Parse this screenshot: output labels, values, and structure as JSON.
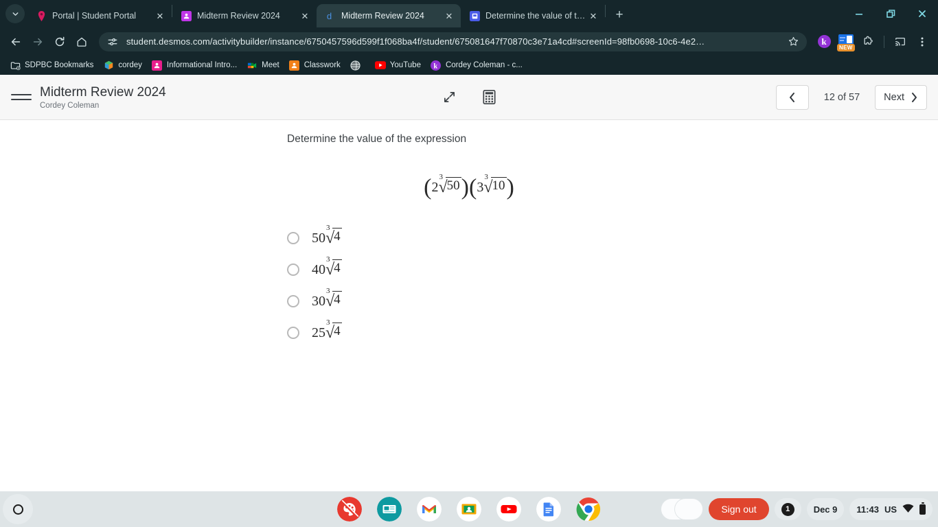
{
  "browser": {
    "tab_search_icon": "chevron-down-icon",
    "tabs": [
      {
        "title": "Portal | Student Portal",
        "favicon": "portal-pin-icon",
        "active": false
      },
      {
        "title": "Midterm Review 2024",
        "favicon": "classroom-icon",
        "active": false
      },
      {
        "title": "Midterm Review 2024",
        "favicon": "desmos-icon",
        "active": true
      },
      {
        "title": "Determine the value of the exp...",
        "favicon": "slides-icon",
        "active": false
      }
    ],
    "new_tab_label": "+",
    "window_controls": {
      "minimize": "minimize-icon",
      "maximize": "restore-icon",
      "close": "close-icon"
    },
    "toolbar": {
      "back_icon": "back-arrow-icon",
      "forward_icon": "forward-arrow-icon",
      "reload_icon": "reload-icon",
      "home_icon": "home-icon",
      "site_info_icon": "site-settings-icon",
      "url": "student.desmos.com/activitybuilder/instance/6750457596d599f1f068ba4f/student/675081647f70870c3e71a4cd#screenId=98fb0698-10c6-4e2…",
      "star_icon": "bookmark-star-icon",
      "extension_k_label": "k",
      "extension_new_badge": "NEW",
      "extensions_icon": "puzzle-piece-icon",
      "cast_icon": "cast-icon",
      "menu_icon": "three-dot-menu-icon"
    },
    "bookmarks": [
      {
        "label": "SDPBC Bookmarks",
        "icon": "folder-bookmarks-icon"
      },
      {
        "label": "cordey",
        "icon": "cube-icon"
      },
      {
        "label": "Informational Intro...",
        "icon": "contact-pink-icon"
      },
      {
        "label": "Meet",
        "icon": "google-meet-icon"
      },
      {
        "label": "Classwork",
        "icon": "classroom-orange-icon"
      },
      {
        "label": "",
        "icon": "globe-gray-icon"
      },
      {
        "label": "YouTube",
        "icon": "youtube-icon"
      },
      {
        "label": "Cordey Coleman - c...",
        "icon": "kami-icon"
      }
    ]
  },
  "app": {
    "menu_icon": "hamburger-menu-icon",
    "title": "Midterm Review 2024",
    "student_name": "Cordey Coleman",
    "expand_icon": "expand-diagonal-icon",
    "calculator_icon": "calculator-icon",
    "prev_icon": "chevron-left-icon",
    "page_counter": "12 of 57",
    "next_label": "Next",
    "next_icon": "chevron-right-icon"
  },
  "question": {
    "prompt": "Determine the value of the expression",
    "expression": {
      "open1": "(",
      "coef1": "2",
      "index1": "3",
      "radicand1": "50",
      "close1": ")",
      "open2": "(",
      "coef2": "3",
      "index2": "3",
      "radicand2": "10",
      "close2": ")"
    },
    "choices": [
      {
        "coefficient": "50",
        "index": "3",
        "radicand": "4",
        "selected": false
      },
      {
        "coefficient": "40",
        "index": "3",
        "radicand": "4",
        "selected": false
      },
      {
        "coefficient": "30",
        "index": "3",
        "radicand": "4",
        "selected": false
      },
      {
        "coefficient": "25",
        "index": "3",
        "radicand": "4",
        "selected": false
      }
    ]
  },
  "shelf": {
    "launcher_icon": "launcher-circle-icon",
    "apps": [
      {
        "name": "paint-blocked-icon",
        "open": false
      },
      {
        "name": "news-teal-icon",
        "open": false
      },
      {
        "name": "gmail-icon",
        "open": false
      },
      {
        "name": "google-classroom-icon",
        "open": true
      },
      {
        "name": "youtube-icon",
        "open": false
      },
      {
        "name": "google-docs-icon",
        "open": false
      },
      {
        "name": "google-chrome-icon",
        "open": true
      }
    ],
    "window_preview_icon": "window-preview-thumbnail",
    "sign_out_label": "Sign out",
    "notification_count": "1",
    "date": "Dec 9",
    "time": "11:43",
    "locale": "US",
    "wifi_icon": "wifi-icon",
    "battery_icon": "battery-icon"
  },
  "colors": {
    "browser_chrome": "#15262b",
    "active_tab": "#2a3f43",
    "shelf": "#dee4e6",
    "sign_out": "#e0452e",
    "app_header": "#f7f7f7"
  }
}
